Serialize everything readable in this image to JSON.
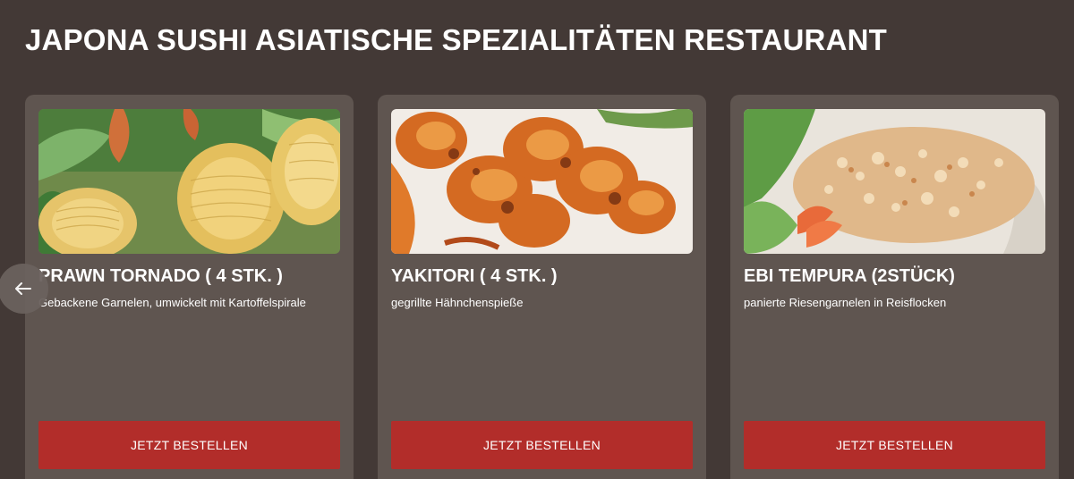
{
  "page": {
    "title": "JAPONA SUSHI ASIATISCHE SPEZIALITÄTEN RESTAURANT"
  },
  "carousel": {
    "prev_icon": "arrow-left-icon",
    "cards": [
      {
        "title": "PRAWN TORNADO ( 4 STK. )",
        "description": "Gebackene Garnelen, umwickelt mit Kartoffelspirale",
        "button_label": "JETZT BESTELLEN",
        "image_label": "prawn-tornado-photo"
      },
      {
        "title": "YAKITORI ( 4 STK. )",
        "description": "gegrillte Hähnchenspieße",
        "button_label": "JETZT BESTELLEN",
        "image_label": "yakitori-photo"
      },
      {
        "title": "EBI TEMPURA (2STÜCK)",
        "description": "panierte Riesengarnelen in Reisflocken",
        "button_label": "JETZT BESTELLEN",
        "image_label": "ebi-tempura-photo"
      }
    ]
  },
  "colors": {
    "background": "#433936",
    "card": "#5f5550",
    "button": "#b22d2a",
    "text": "#ffffff"
  }
}
